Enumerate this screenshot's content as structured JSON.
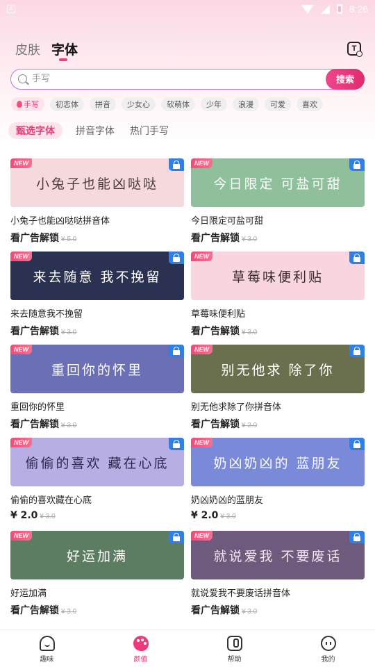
{
  "status_bar": {
    "time": "8:26",
    "sim_label": "A"
  },
  "header": {
    "tabs": [
      "皮肤",
      "字体"
    ],
    "active_tab": "字体"
  },
  "search": {
    "placeholder": "手写",
    "button_label": "搜索"
  },
  "chips": [
    "手写",
    "初恋体",
    "拼音",
    "少女心",
    "软萌体",
    "少年",
    "浪漫",
    "可爱",
    "喜欢"
  ],
  "subtabs": [
    "甄选字体",
    "拼音字体",
    "热门手写"
  ],
  "cards": [
    {
      "badge": "NEW",
      "preview": "小兔子也能凶哒哒",
      "title": "小兔子也能凶哒哒拼音体",
      "price": "看广告解锁",
      "old_price": "¥ 5.0",
      "bg": "#f6d9dc",
      "fg": "#4a3b3d",
      "locked": true
    },
    {
      "badge": "NEW",
      "preview": "今日限定 可盐可甜",
      "title": "今日限定可盐可甜",
      "price": "看广告解锁",
      "old_price": "¥ 3.0",
      "bg": "#8fbf9b",
      "fg": "#ffffff",
      "locked": true
    },
    {
      "badge": "NEW",
      "preview": "来去随意 我不挽留",
      "title": "来去随意我不挽留",
      "price": "看广告解锁",
      "old_price": "¥ 3.0",
      "bg": "#2b3150",
      "fg": "#ffffff",
      "locked": true
    },
    {
      "badge": "NEW",
      "preview": "草莓味便利贴",
      "title": "草莓味便利贴",
      "price": "看广告解锁",
      "old_price": "¥ 3.0",
      "bg": "#f9d5e0",
      "fg": "#3b2a2e",
      "locked": true
    },
    {
      "badge": "NEW",
      "preview": "重回你的怀里",
      "title": "重回你的怀里",
      "price": "看广告解锁",
      "old_price": "¥ 3.0",
      "bg": "#6b6fb5",
      "fg": "#ffffff",
      "locked": true
    },
    {
      "badge": "NEW",
      "preview": "别无他求 除了你",
      "title": "别无他求除了你拼音体",
      "price": "看广告解锁",
      "old_price": "¥ 2.0",
      "bg": "#6a6f4e",
      "fg": "#ffffff",
      "locked": true
    },
    {
      "badge": "NEW",
      "preview": "偷偷的喜欢 藏在心底",
      "title": "偷偷的喜欢藏在心底",
      "price": "¥ 2.0",
      "old_price": "¥ 3.0",
      "bg": "#b7aee3",
      "fg": "#2c2850",
      "locked": false
    },
    {
      "badge": "NEW",
      "preview": "奶凶奶凶的 蓝朋友",
      "title": "奶凶奶凶的蓝朋友",
      "price": "¥ 2.0",
      "old_price": "¥ 3.0",
      "bg": "#7a8ad8",
      "fg": "#ffffff",
      "locked": false
    },
    {
      "badge": "NEW",
      "preview": "好运加满",
      "title": "好运加满",
      "price": "看广告解锁",
      "old_price": "¥ 3.0",
      "bg": "#5d7d62",
      "fg": "#ffffff",
      "locked": true
    },
    {
      "badge": "NEW",
      "preview": "就说爱我 不要废话",
      "title": "就说爱我不要废话拼音体",
      "price": "看广告解锁",
      "old_price": "¥ 3.0",
      "bg": "#6e5a7c",
      "fg": "#f0e6f2",
      "locked": true
    }
  ],
  "bottom_nav": [
    {
      "label": "趣味",
      "icon": "ghost-icon"
    },
    {
      "label": "颜值",
      "icon": "palette-icon"
    },
    {
      "label": "帮助",
      "icon": "help-icon"
    },
    {
      "label": "我的",
      "icon": "face-icon"
    }
  ],
  "colors": {
    "accent": "#e23d7b",
    "lock": "#2f7fe8",
    "search_border": "#b878d8"
  }
}
